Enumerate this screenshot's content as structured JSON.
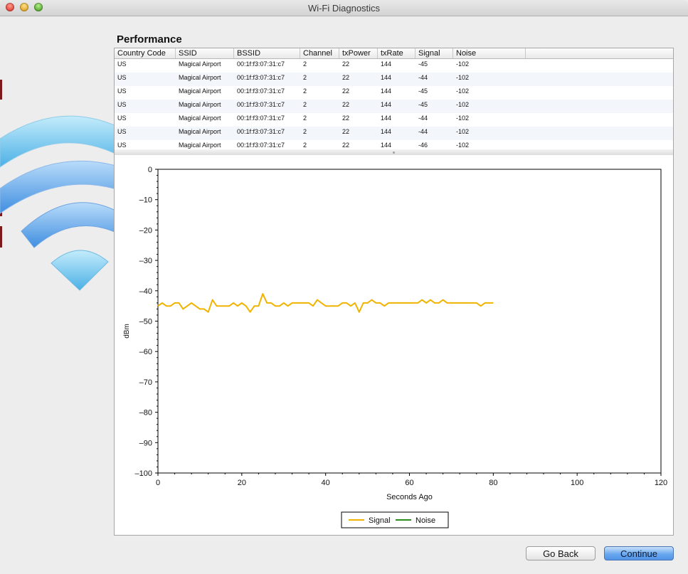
{
  "window": {
    "title": "Wi-Fi Diagnostics"
  },
  "section": {
    "title": "Performance"
  },
  "table": {
    "columns": [
      "Country Code",
      "SSID",
      "BSSID",
      "Channel",
      "txPower",
      "txRate",
      "Signal",
      "Noise"
    ],
    "rows": [
      [
        "US",
        "Magical Airport",
        "00:1f:f3:07:31:c7",
        "2",
        "22",
        "144",
        "-45",
        "-102"
      ],
      [
        "US",
        "Magical Airport",
        "00:1f:f3:07:31:c7",
        "2",
        "22",
        "144",
        "-44",
        "-102"
      ],
      [
        "US",
        "Magical Airport",
        "00:1f:f3:07:31:c7",
        "2",
        "22",
        "144",
        "-45",
        "-102"
      ],
      [
        "US",
        "Magical Airport",
        "00:1f:f3:07:31:c7",
        "2",
        "22",
        "144",
        "-45",
        "-102"
      ],
      [
        "US",
        "Magical Airport",
        "00:1f:f3:07:31:c7",
        "2",
        "22",
        "144",
        "-44",
        "-102"
      ],
      [
        "US",
        "Magical Airport",
        "00:1f:f3:07:31:c7",
        "2",
        "22",
        "144",
        "-44",
        "-102"
      ],
      [
        "US",
        "Magical Airport",
        "00:1f:f3:07:31:c7",
        "2",
        "22",
        "144",
        "-46",
        "-102"
      ]
    ]
  },
  "chart_data": {
    "type": "line",
    "xlabel": "Seconds Ago",
    "ylabel": "dBm",
    "xlim": [
      0,
      120
    ],
    "ylim": [
      -100,
      0
    ],
    "x_ticks": [
      0,
      20,
      40,
      60,
      80,
      100,
      120
    ],
    "y_ticks": [
      0,
      -10,
      -20,
      -30,
      -40,
      -50,
      -60,
      -70,
      -80,
      -90,
      -100
    ],
    "legend_position": "bottom-center",
    "grid": false,
    "series": [
      {
        "name": "Signal",
        "color": "#f0b400",
        "x": [
          0,
          1,
          2,
          3,
          4,
          5,
          6,
          7,
          8,
          9,
          10,
          11,
          12,
          13,
          14,
          15,
          16,
          17,
          18,
          19,
          20,
          21,
          22,
          23,
          24,
          25,
          26,
          27,
          28,
          29,
          30,
          31,
          32,
          33,
          34,
          35,
          36,
          37,
          38,
          39,
          40,
          41,
          42,
          43,
          44,
          45,
          46,
          47,
          48,
          49,
          50,
          51,
          52,
          53,
          54,
          55,
          56,
          57,
          58,
          59,
          60,
          61,
          62,
          63,
          64,
          65,
          66,
          67,
          68,
          69,
          70,
          71,
          72,
          73,
          74,
          75,
          76,
          77,
          78,
          79,
          80
        ],
        "values": [
          -45,
          -44,
          -45,
          -45,
          -44,
          -44,
          -46,
          -45,
          -44,
          -45,
          -46,
          -46,
          -47,
          -43,
          -45,
          -45,
          -45,
          -45,
          -44,
          -45,
          -44,
          -45,
          -47,
          -45,
          -45,
          -41,
          -44,
          -44,
          -45,
          -45,
          -44,
          -45,
          -44,
          -44,
          -44,
          -44,
          -44,
          -45,
          -43,
          -44,
          -45,
          -45,
          -45,
          -45,
          -44,
          -44,
          -45,
          -44,
          -47,
          -44,
          -44,
          -43,
          -44,
          -44,
          -45,
          -44,
          -44,
          -44,
          -44,
          -44,
          -44,
          -44,
          -44,
          -43,
          -44,
          -43,
          -44,
          -44,
          -43,
          -44,
          -44,
          -44,
          -44,
          -44,
          -44,
          -44,
          -44,
          -45,
          -44,
          -44,
          -44
        ]
      },
      {
        "name": "Noise",
        "color": "#2e8b1f",
        "x": [],
        "values": []
      }
    ]
  },
  "buttons": {
    "back": "Go Back",
    "continue": "Continue"
  }
}
